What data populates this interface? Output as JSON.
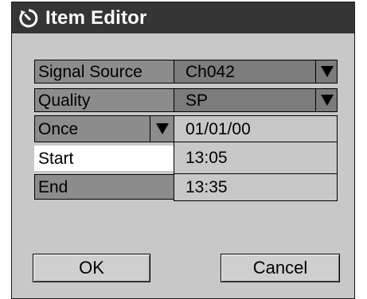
{
  "dialog": {
    "title": "Item Editor",
    "title_icon": "timer-icon"
  },
  "rows": {
    "signal_source": {
      "label": "Signal Source",
      "value": "Ch042"
    },
    "quality": {
      "label": "Quality",
      "value": "SP"
    },
    "repeat": {
      "label": "Once",
      "value": "01/01/00"
    },
    "start": {
      "label": "Start",
      "value": "13:05"
    },
    "end": {
      "label": "End",
      "value": "13:35"
    }
  },
  "buttons": {
    "ok": "OK",
    "cancel": "Cancel"
  },
  "colors": {
    "titlebar": "#353535",
    "panel": "#c8c8c8",
    "highlight": "#ffffff",
    "field_dark": "#8c8c8c"
  }
}
